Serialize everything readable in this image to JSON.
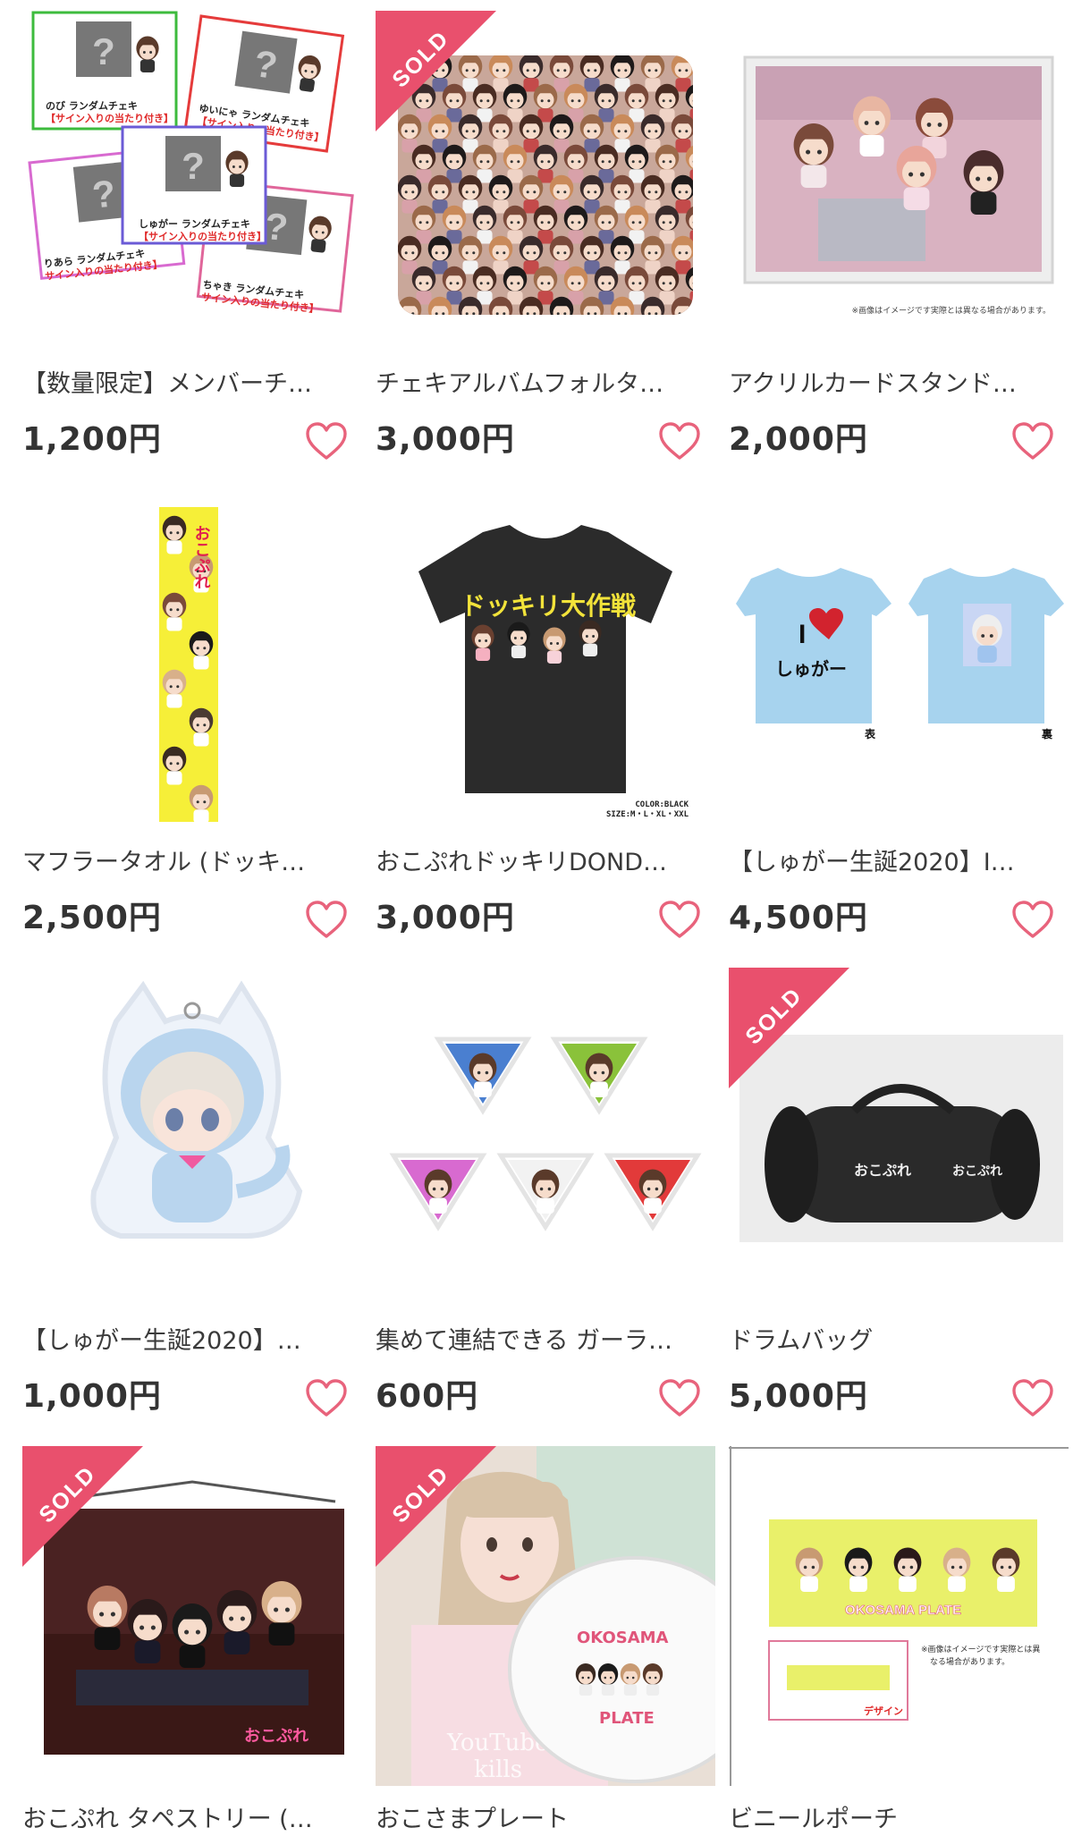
{
  "products": [
    {
      "title": "【数量限定】メンバーチ…",
      "price": "1,200円",
      "sold": false,
      "image": "random-cheki-cards"
    },
    {
      "title": "チェキアルバムフォルタ…",
      "price": "3,000円",
      "sold": true,
      "sold_label": "SOLD",
      "image": "cheki-album-pattern"
    },
    {
      "title": "アクリルカードスタンド…",
      "price": "2,000円",
      "sold": false,
      "image": "acrylic-card-stand",
      "image_note": "※画像はイメージです実際とは異なる場合があります。"
    },
    {
      "title": "マフラータオル (ドッキ…",
      "price": "2,500円",
      "sold": false,
      "image": "muffler-towel"
    },
    {
      "title": "おこぷれドッキリDOND…",
      "price": "3,000円",
      "sold": false,
      "image": "black-tshirt",
      "image_text": [
        "ドッキリ大作戦",
        "COLOR:BLACK",
        "SIZE:M・L・XL・XXL"
      ]
    },
    {
      "title": "【しゅがー生誕2020】I…",
      "price": "4,500円",
      "sold": false,
      "image": "light-blue-tshirts",
      "image_text": [
        "I",
        "しゅがー",
        "表",
        "裏"
      ]
    },
    {
      "title": "【しゅがー生誕2020】…",
      "price": "1,000円",
      "sold": false,
      "image": "cat-acrylic-keychain"
    },
    {
      "title": "集めて連結できる ガーラ…",
      "price": "600円",
      "sold": false,
      "image": "garland-pennants"
    },
    {
      "title": "ドラムバッグ",
      "price": "5,000円",
      "sold": true,
      "sold_label": "SOLD",
      "image": "drum-bag"
    },
    {
      "title": "おこぷれ タペストリー (…",
      "price": "",
      "sold": true,
      "sold_label": "SOLD",
      "image": "tapestry"
    },
    {
      "title": "おこさまプレート",
      "price": "",
      "sold": true,
      "sold_label": "SOLD",
      "image": "plate-photo",
      "image_text": [
        "OKOSAMA",
        "PLATE",
        "YouTuber",
        "kills"
      ]
    },
    {
      "title": "ビニールポーチ",
      "price": "",
      "sold": false,
      "image": "vinyl-pouch",
      "image_text": [
        "OKOSAMA PLATE",
        "※画像はイメージです実際とは異なる場合があります。",
        "デザイン"
      ]
    }
  ],
  "cheki_labels": [
    {
      "name": "のび ランダムチェキ",
      "sub": "【サイン入りの当たり付き】"
    },
    {
      "name": "ゆいにゃ ランダムチェキ",
      "sub": "【サイン入りの当たり付き】"
    },
    {
      "name": "しゅがー ランダムチェキ",
      "sub": "【サイン入りの当たり付き】"
    },
    {
      "name": "りあら ランダムチェキ",
      "sub": "サイン入りの当たり付き】"
    },
    {
      "name": "ちゃき ランダムチェキ",
      "sub": "サイン入りの当たり付き】"
    }
  ],
  "colors": {
    "accent_pink": "#e9506d",
    "heart_pink": "#e8637c",
    "text": "#333333"
  },
  "icons": {
    "favorite": "heart-outline-icon"
  }
}
